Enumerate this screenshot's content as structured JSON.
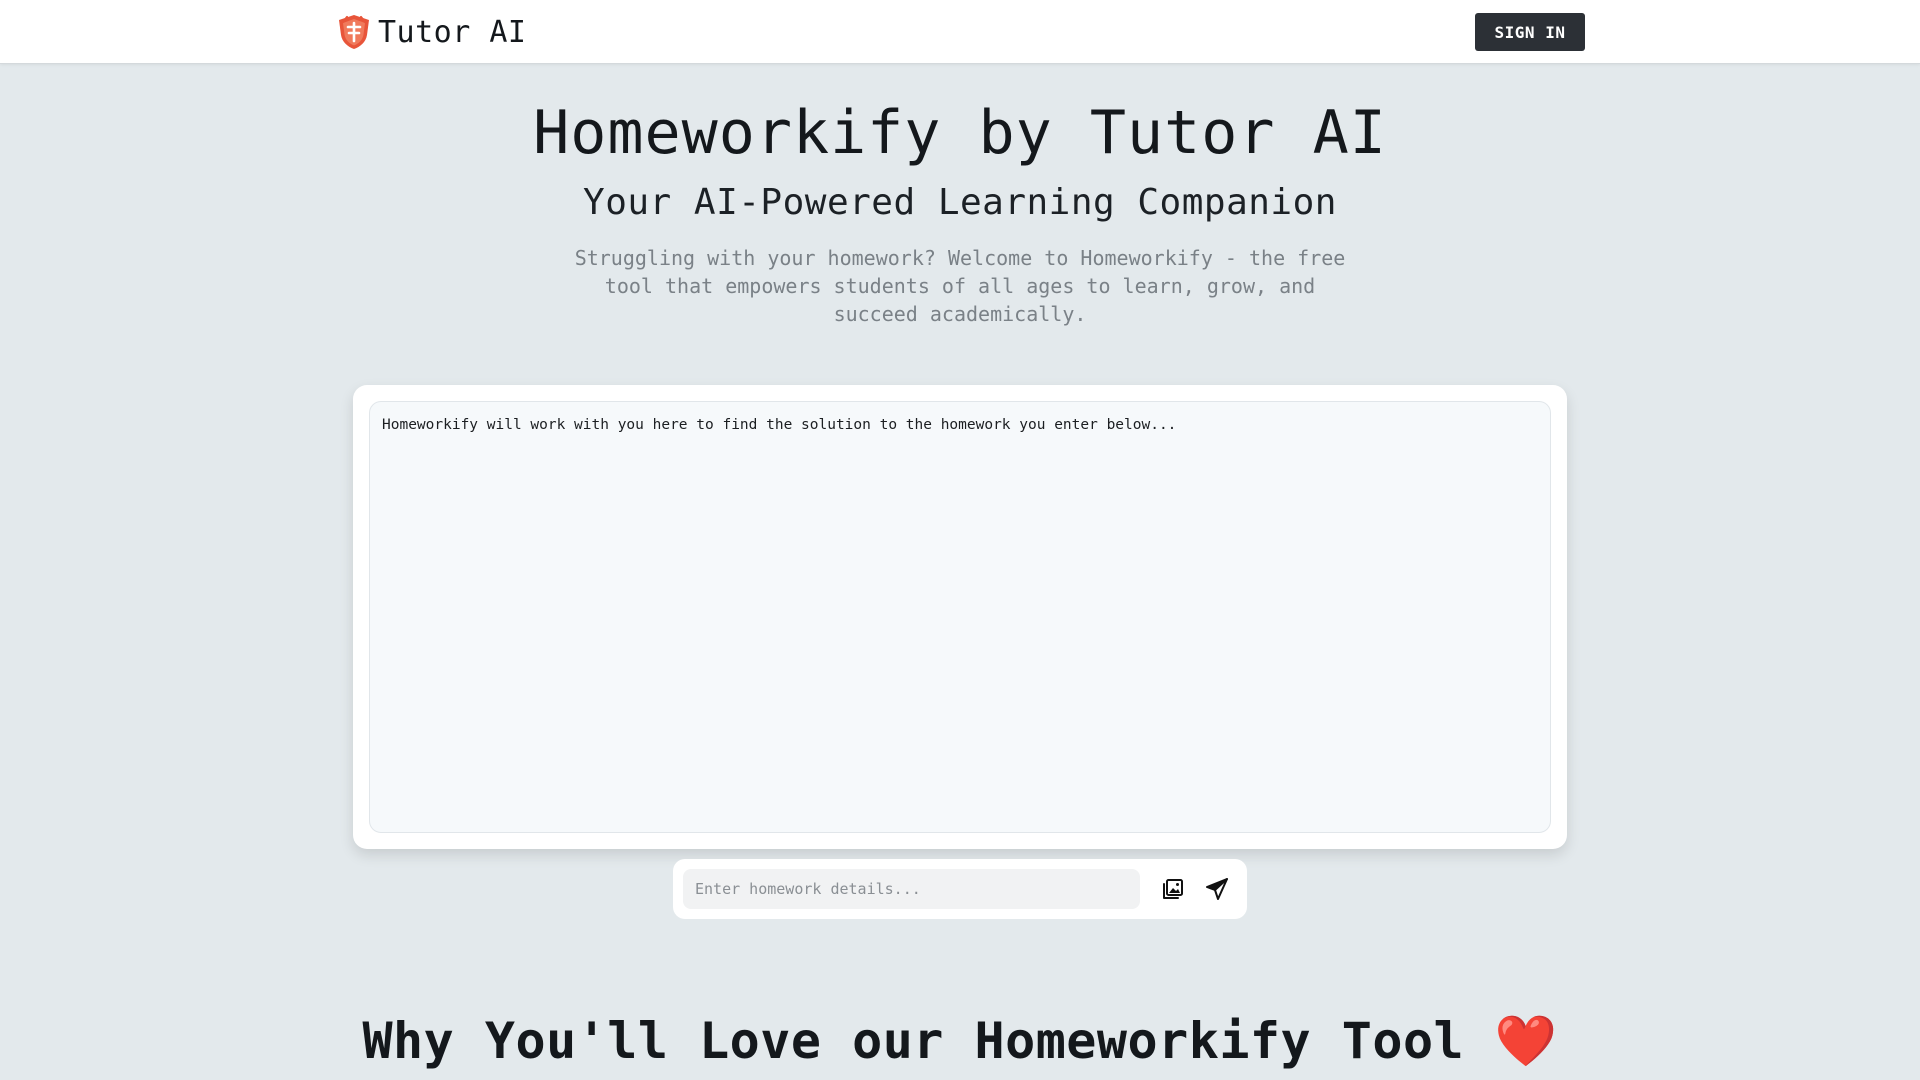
{
  "header": {
    "brand_name": "Tutor AI",
    "logo_icon": "shield-logo-icon",
    "signin_label": "SIGN IN"
  },
  "hero": {
    "title": "Homeworkify by Tutor AI",
    "subtitle": "Your AI-Powered Learning Companion",
    "description": "Struggling with your homework? Welcome to Homeworkify - the free tool that empowers students of all ages to learn, grow, and succeed academically."
  },
  "chat": {
    "intro_message": "Homeworkify will work with you here to find the solution to the homework you enter below..."
  },
  "input": {
    "placeholder": "Enter homework details...",
    "value": "",
    "upload_icon": "image-upload-icon",
    "send_icon": "send-icon"
  },
  "features": {
    "heading": "Why You'll Love our Homeworkify Tool",
    "heading_emoji": "❤️"
  },
  "colors": {
    "page_background": "#e3e9ec",
    "signin_button": "#2c3036",
    "brand_accent": "#e8553a",
    "heart": "#e0242a"
  }
}
